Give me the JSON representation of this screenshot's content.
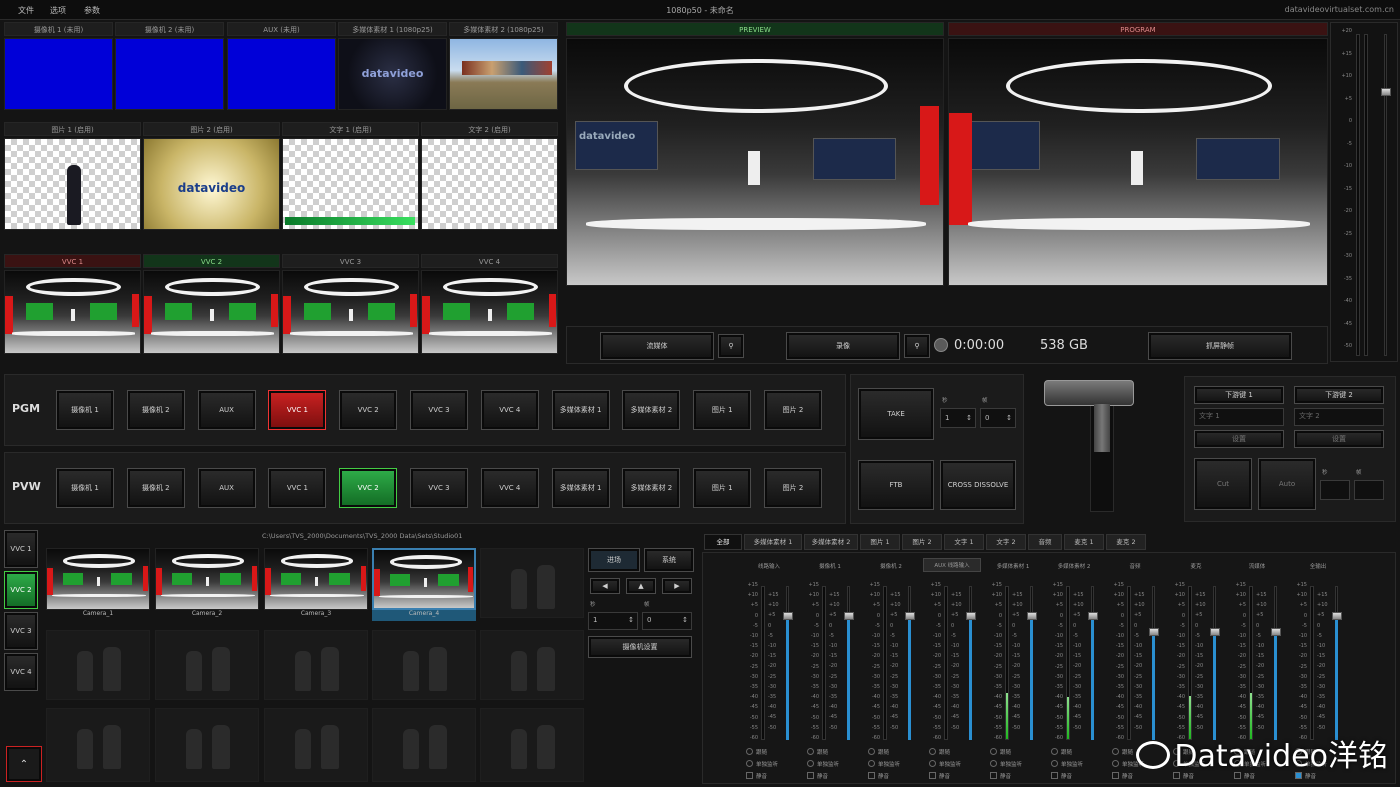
{
  "topbar": {
    "menu": [
      "文件",
      "选项",
      "参数"
    ],
    "title": "1080p50 - 未命名",
    "site": "datavideovirtualset.com.cn"
  },
  "sources_row1": [
    "摄像机 1 (未用)",
    "摄像机 2 (未用)",
    "AUX (未用)",
    "多媒体素材 1 (1080p25)",
    "多媒体素材 2 (1080p25)"
  ],
  "sources_row2": [
    "图片 1 (启用)",
    "图片 2 (启用)",
    "文字 1 (启用)",
    "文字 2 (启用)"
  ],
  "sources_row3": [
    "VVC 1",
    "VVC 2",
    "VVC 3",
    "VVC 4"
  ],
  "source_logos": {
    "media1": "datavideo",
    "pic2": "datavideo"
  },
  "preview": {
    "label": "PREVIEW",
    "studio_logo": "datavideo"
  },
  "program": {
    "label": "PROGRAM"
  },
  "transport": {
    "stream_btn": "流媒体",
    "record_btn": "录像",
    "timecode": "0:00:00",
    "storage": "538 GB",
    "snapshot_btn": "抓屏静帧"
  },
  "master_scale": [
    "+20",
    "+15",
    "+10",
    "+5",
    "0",
    "-5",
    "-10",
    "-15",
    "-20",
    "-25",
    "-30",
    "-35",
    "-40",
    "-45",
    "-50"
  ],
  "pgm": {
    "label": "PGM",
    "buttons": [
      "摄像机 1",
      "摄像机 2",
      "AUX",
      "VVC 1",
      "VVC 2",
      "VVC 3",
      "VVC 4",
      "多媒体素材 1",
      "多媒体素材 2",
      "图片 1",
      "图片 2"
    ],
    "active_index": 3
  },
  "pvw": {
    "label": "PVW",
    "buttons": [
      "摄像机 1",
      "摄像机 2",
      "AUX",
      "VVC 1",
      "VVC 2",
      "VVC 3",
      "VVC 4",
      "多媒体素材 1",
      "多媒体素材 2",
      "图片 1",
      "图片 2"
    ],
    "active_index": 4
  },
  "transition": {
    "take": "TAKE",
    "ftb": "FTB",
    "cross": "CROSS DISSOLVE",
    "sec_label": "秒",
    "frame_label": "帧",
    "sec_value": "1",
    "frame_value": "0"
  },
  "dsk": {
    "key1": "下游键 1",
    "key2": "下游键 2",
    "field1": "文字 1",
    "field2": "文字 2",
    "setting": "设置",
    "cut": "Cut",
    "auto": "Auto",
    "sec_label": "秒",
    "frame_label": "帧"
  },
  "vvc_side": [
    "VVC 1",
    "VVC 2",
    "VVC 3",
    "VVC 4"
  ],
  "vvc_side_active": 1,
  "camera_path": "C:\\Users\\TVS_2000\\Documents\\TVS_2000 Data\\Sets\\Studio01",
  "cameras": [
    "Camera_1",
    "Camera_2",
    "Camera_3",
    "Camera_4"
  ],
  "cam_controls": {
    "tab_a": "进场",
    "tab_b": "系统",
    "sec_label": "秒",
    "frame_label": "帧",
    "sec_value": "1",
    "frame_value": "0",
    "settings_btn": "摄像机设置"
  },
  "audio_tabs": [
    "全部",
    "多媒体素材 1",
    "多媒体素材 2",
    "图片 1",
    "图片 2",
    "文字 1",
    "文字 2",
    "音频",
    "麦克 1",
    "麦克 2"
  ],
  "audio_channels": [
    {
      "name": "线路输入",
      "level": 0
    },
    {
      "name": "摄像机 1",
      "level": 0
    },
    {
      "name": "摄像机 2",
      "level": 0
    },
    {
      "name": "AUX 线路输入",
      "level": 0
    },
    {
      "name": "多媒体素材 1",
      "level": 0.55
    },
    {
      "name": "多媒体素材 2",
      "level": 0.5
    },
    {
      "name": "音频",
      "level": 0
    },
    {
      "name": "麦克",
      "level": 0.52
    },
    {
      "name": "流媒体",
      "level": 0.55
    },
    {
      "name": "全输出",
      "level": 0
    }
  ],
  "audio_scale": [
    "+15",
    "+10",
    "+5",
    "0",
    "-5",
    "-10",
    "-15",
    "-20",
    "-25",
    "-30",
    "-35",
    "-40",
    "-45",
    "-50",
    "-55",
    "-60"
  ],
  "audio_checks": [
    "跟随",
    "单独监听",
    "静音"
  ],
  "watermark": "Datavideo洋铭"
}
